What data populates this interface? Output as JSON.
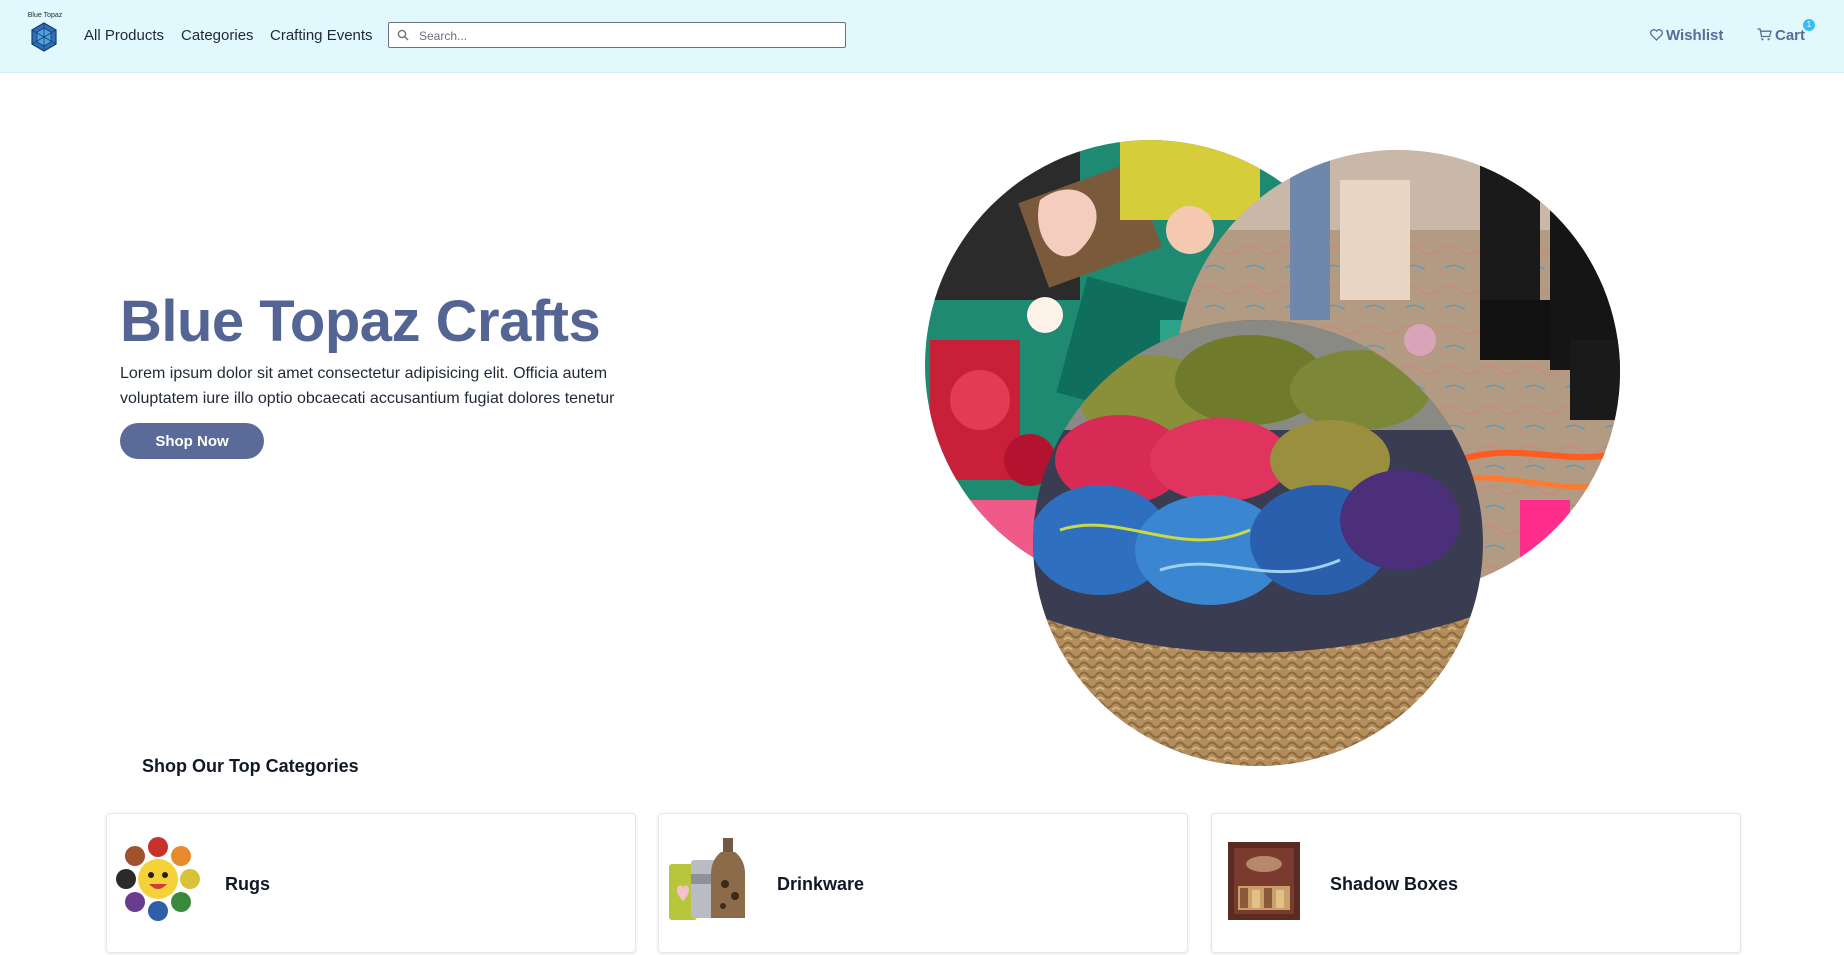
{
  "nav": {
    "logo_text": "Blue Topaz",
    "links": [
      "All Products",
      "Categories",
      "Crafting Events"
    ],
    "search_placeholder": "Search...",
    "wishlist_label": "Wishlist",
    "cart_label": "Cart",
    "cart_count": "1",
    "icons": {
      "search": "search-icon",
      "wishlist": "heart-icon",
      "cart": "cart-icon"
    }
  },
  "hero": {
    "title": "Blue Topaz Crafts",
    "description": "Lorem ipsum dolor sit amet consectetur adipisicing elit. Officia autem voluptatem iure illo optio obcaecati accusantium fugiat dolores tenetur",
    "button_label": "Shop Now"
  },
  "categories": {
    "heading": "Shop Our Top Categories",
    "items": [
      {
        "name": "Rugs"
      },
      {
        "name": "Drinkware"
      },
      {
        "name": "Shadow Boxes"
      }
    ]
  },
  "colors": {
    "nav_bg": "#e1f8fd",
    "accent": "#5b6b99",
    "title": "#546594",
    "badge": "#38bdf8"
  }
}
